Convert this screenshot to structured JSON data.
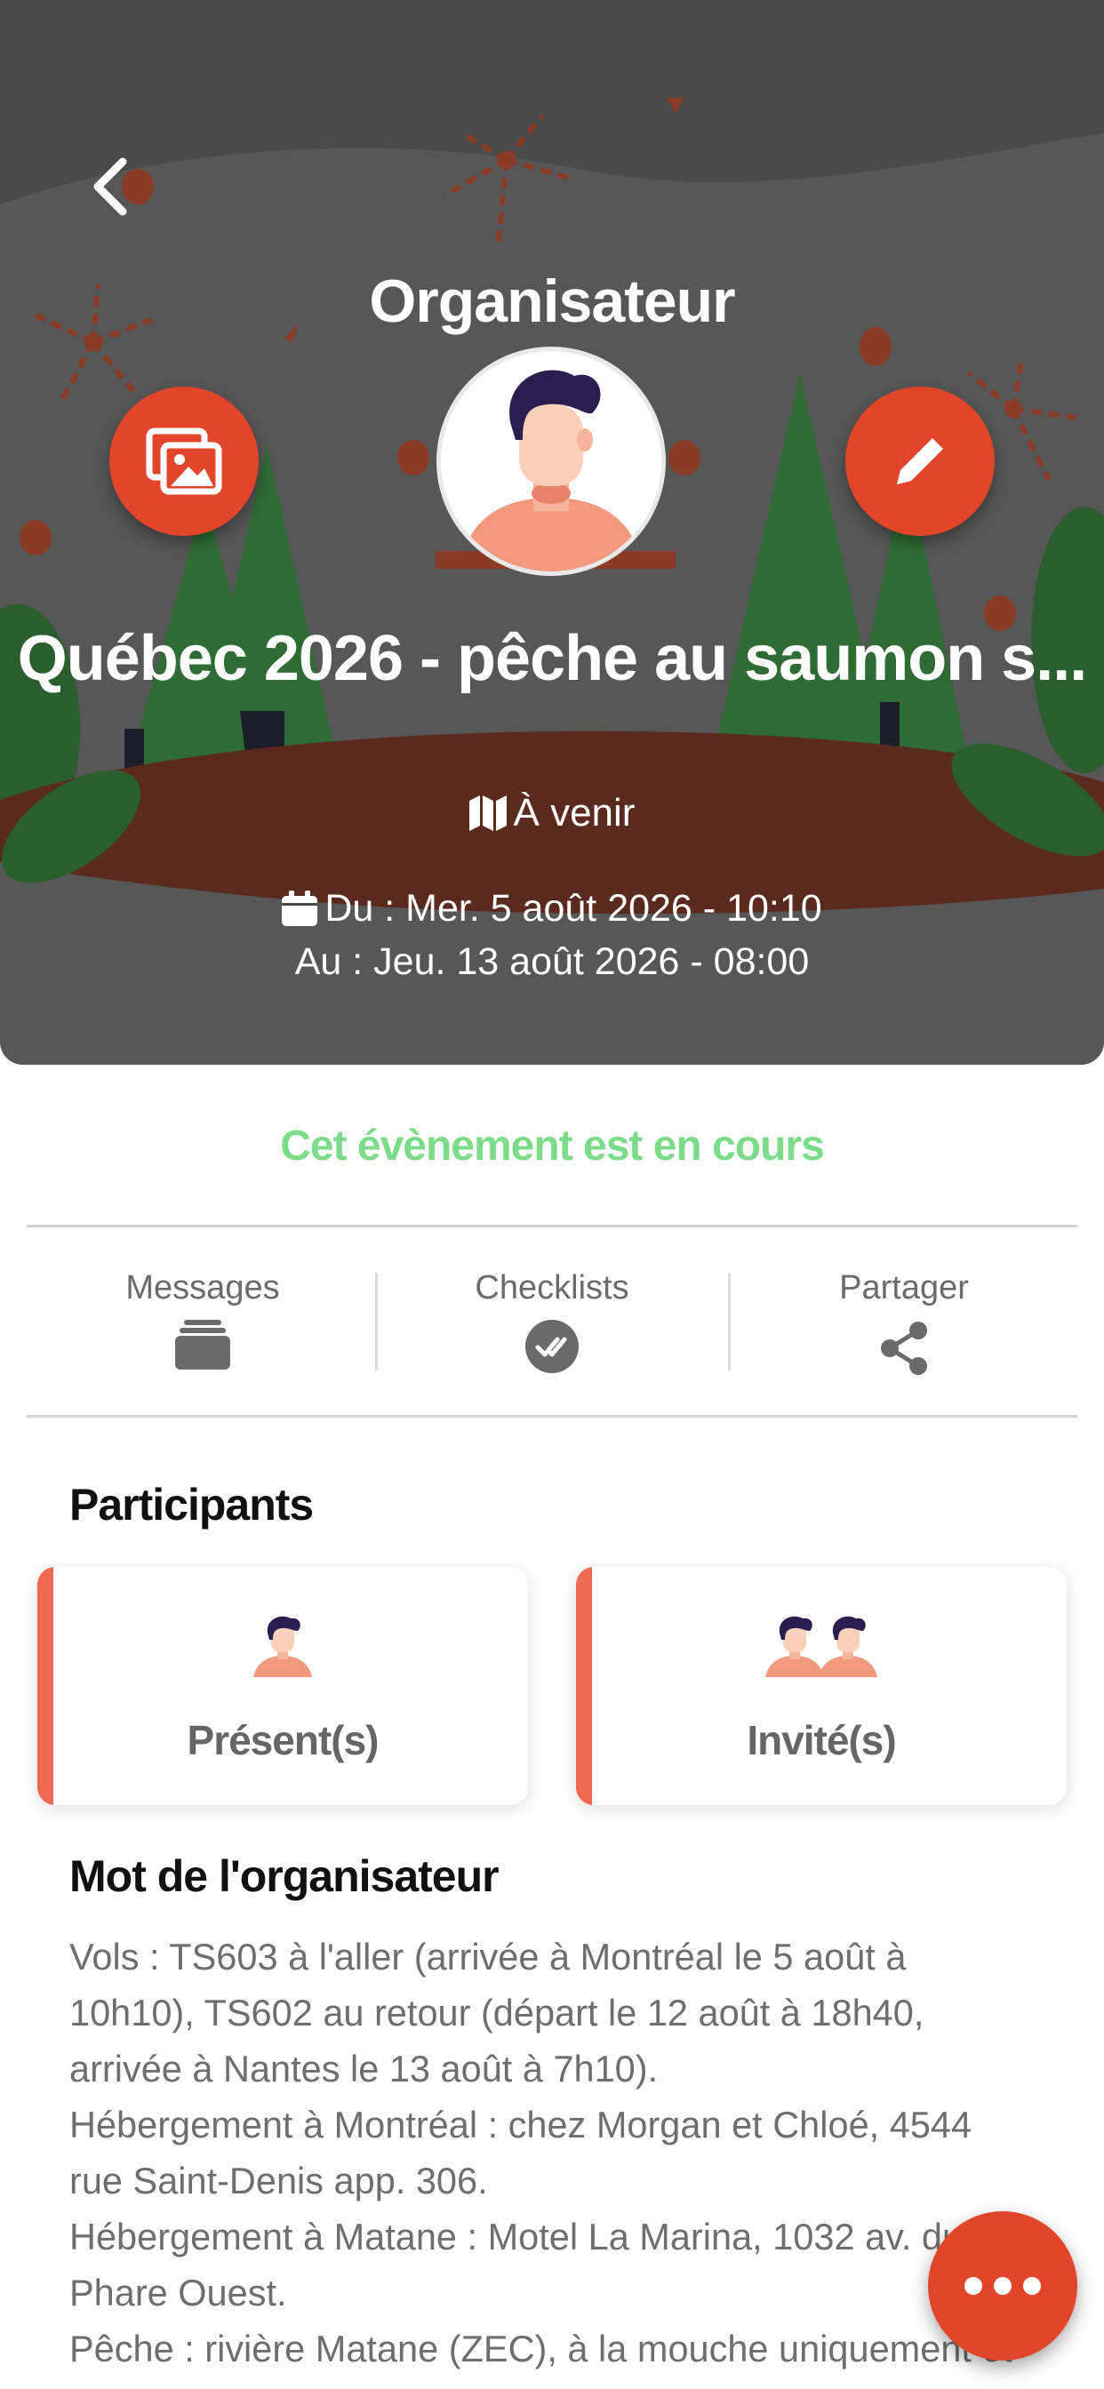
{
  "header": {
    "role_title": "Organisateur",
    "event_title": "Québec 2026 - pêche au saumon s...",
    "status": "À venir",
    "date_from": "Du : Mer. 5 août 2026 - 10:10",
    "date_to": "Au : Jeu. 13 août 2026 - 08:00",
    "icons": {
      "back": "chevron-left-icon",
      "gallery": "images-icon",
      "edit": "pencil-icon",
      "status": "map-icon",
      "date": "calendar-icon"
    }
  },
  "banner": {
    "text": "Cet évènement est en cours",
    "color": "#7ddc8a"
  },
  "actions": [
    {
      "label": "Messages",
      "icon": "folder-stack-icon"
    },
    {
      "label": "Checklists",
      "icon": "double-check-circle-icon"
    },
    {
      "label": "Partager",
      "icon": "share-icon"
    }
  ],
  "participants": {
    "title": "Participants",
    "present_label": "Présent(s)",
    "invited_label": "Invité(s)"
  },
  "organizer_note": {
    "title": "Mot de l'organisateur",
    "lines": [
      "Vols : TS603 à l'aller (arrivée à Montréal le 5 août à 10h10), TS602 au retour (départ le 12 août à 18h40, arrivée à Nantes le 13 août à 7h10).",
      "Hébergement à Montréal : chez Morgan et Chloé, 4544 rue Saint-Denis app. 306.",
      "Hébergement à Matane : Motel La Marina, 1032 av. du Phare Ouest.",
      "Pêche : rivière Matane (ZEC), à la mouche uniquement et"
    ]
  },
  "fab": {
    "icon": "more-dots-icon"
  },
  "colors": {
    "accent": "#e1462a",
    "card_border": "#ee6a52",
    "hero_bg": "#4a4a4a"
  }
}
